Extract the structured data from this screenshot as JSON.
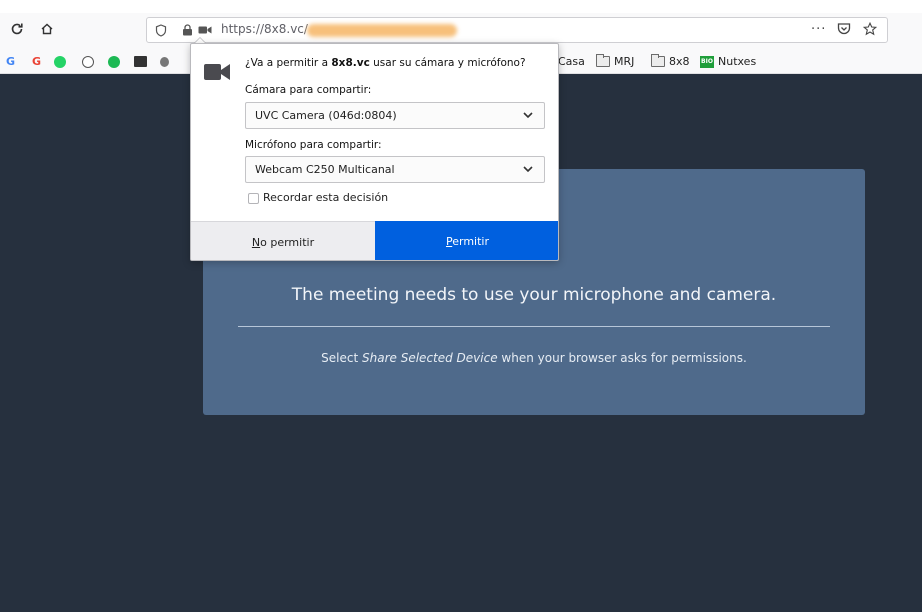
{
  "browser": {
    "url": "https://8x8.vc/",
    "page_actions_label": "···",
    "bookmarks": [
      {
        "label": "Casa"
      },
      {
        "label": "MRJ"
      },
      {
        "label": "8x8"
      },
      {
        "label": "Nutxes"
      }
    ],
    "favicon_letters": [
      "G",
      "G"
    ],
    "nutxes_badge": "BIO"
  },
  "permission_popup": {
    "question_prefix": "¿Va a permitir a ",
    "site": "8x8.vc",
    "question_suffix": " usar su cámara y micrófono?",
    "camera_label": "Cámara para compartir:",
    "camera_value": "UVC Camera (046d:0804)",
    "microphone_label": "Micrófono para compartir:",
    "microphone_value": "Webcam C250 Multicanal",
    "remember_label": "Recordar esta decisión",
    "remember_checked": false,
    "deny_label": "No permitir",
    "allow_label": "Permitir",
    "allow_color": "#0060df"
  },
  "page": {
    "background": "#26303e",
    "card_color": "#4f6a8b",
    "heading": "The meeting needs to use your microphone and camera.",
    "hint_prefix": "Select ",
    "hint_emphasis": "Share Selected Device",
    "hint_suffix": " when your browser asks for permissions."
  }
}
